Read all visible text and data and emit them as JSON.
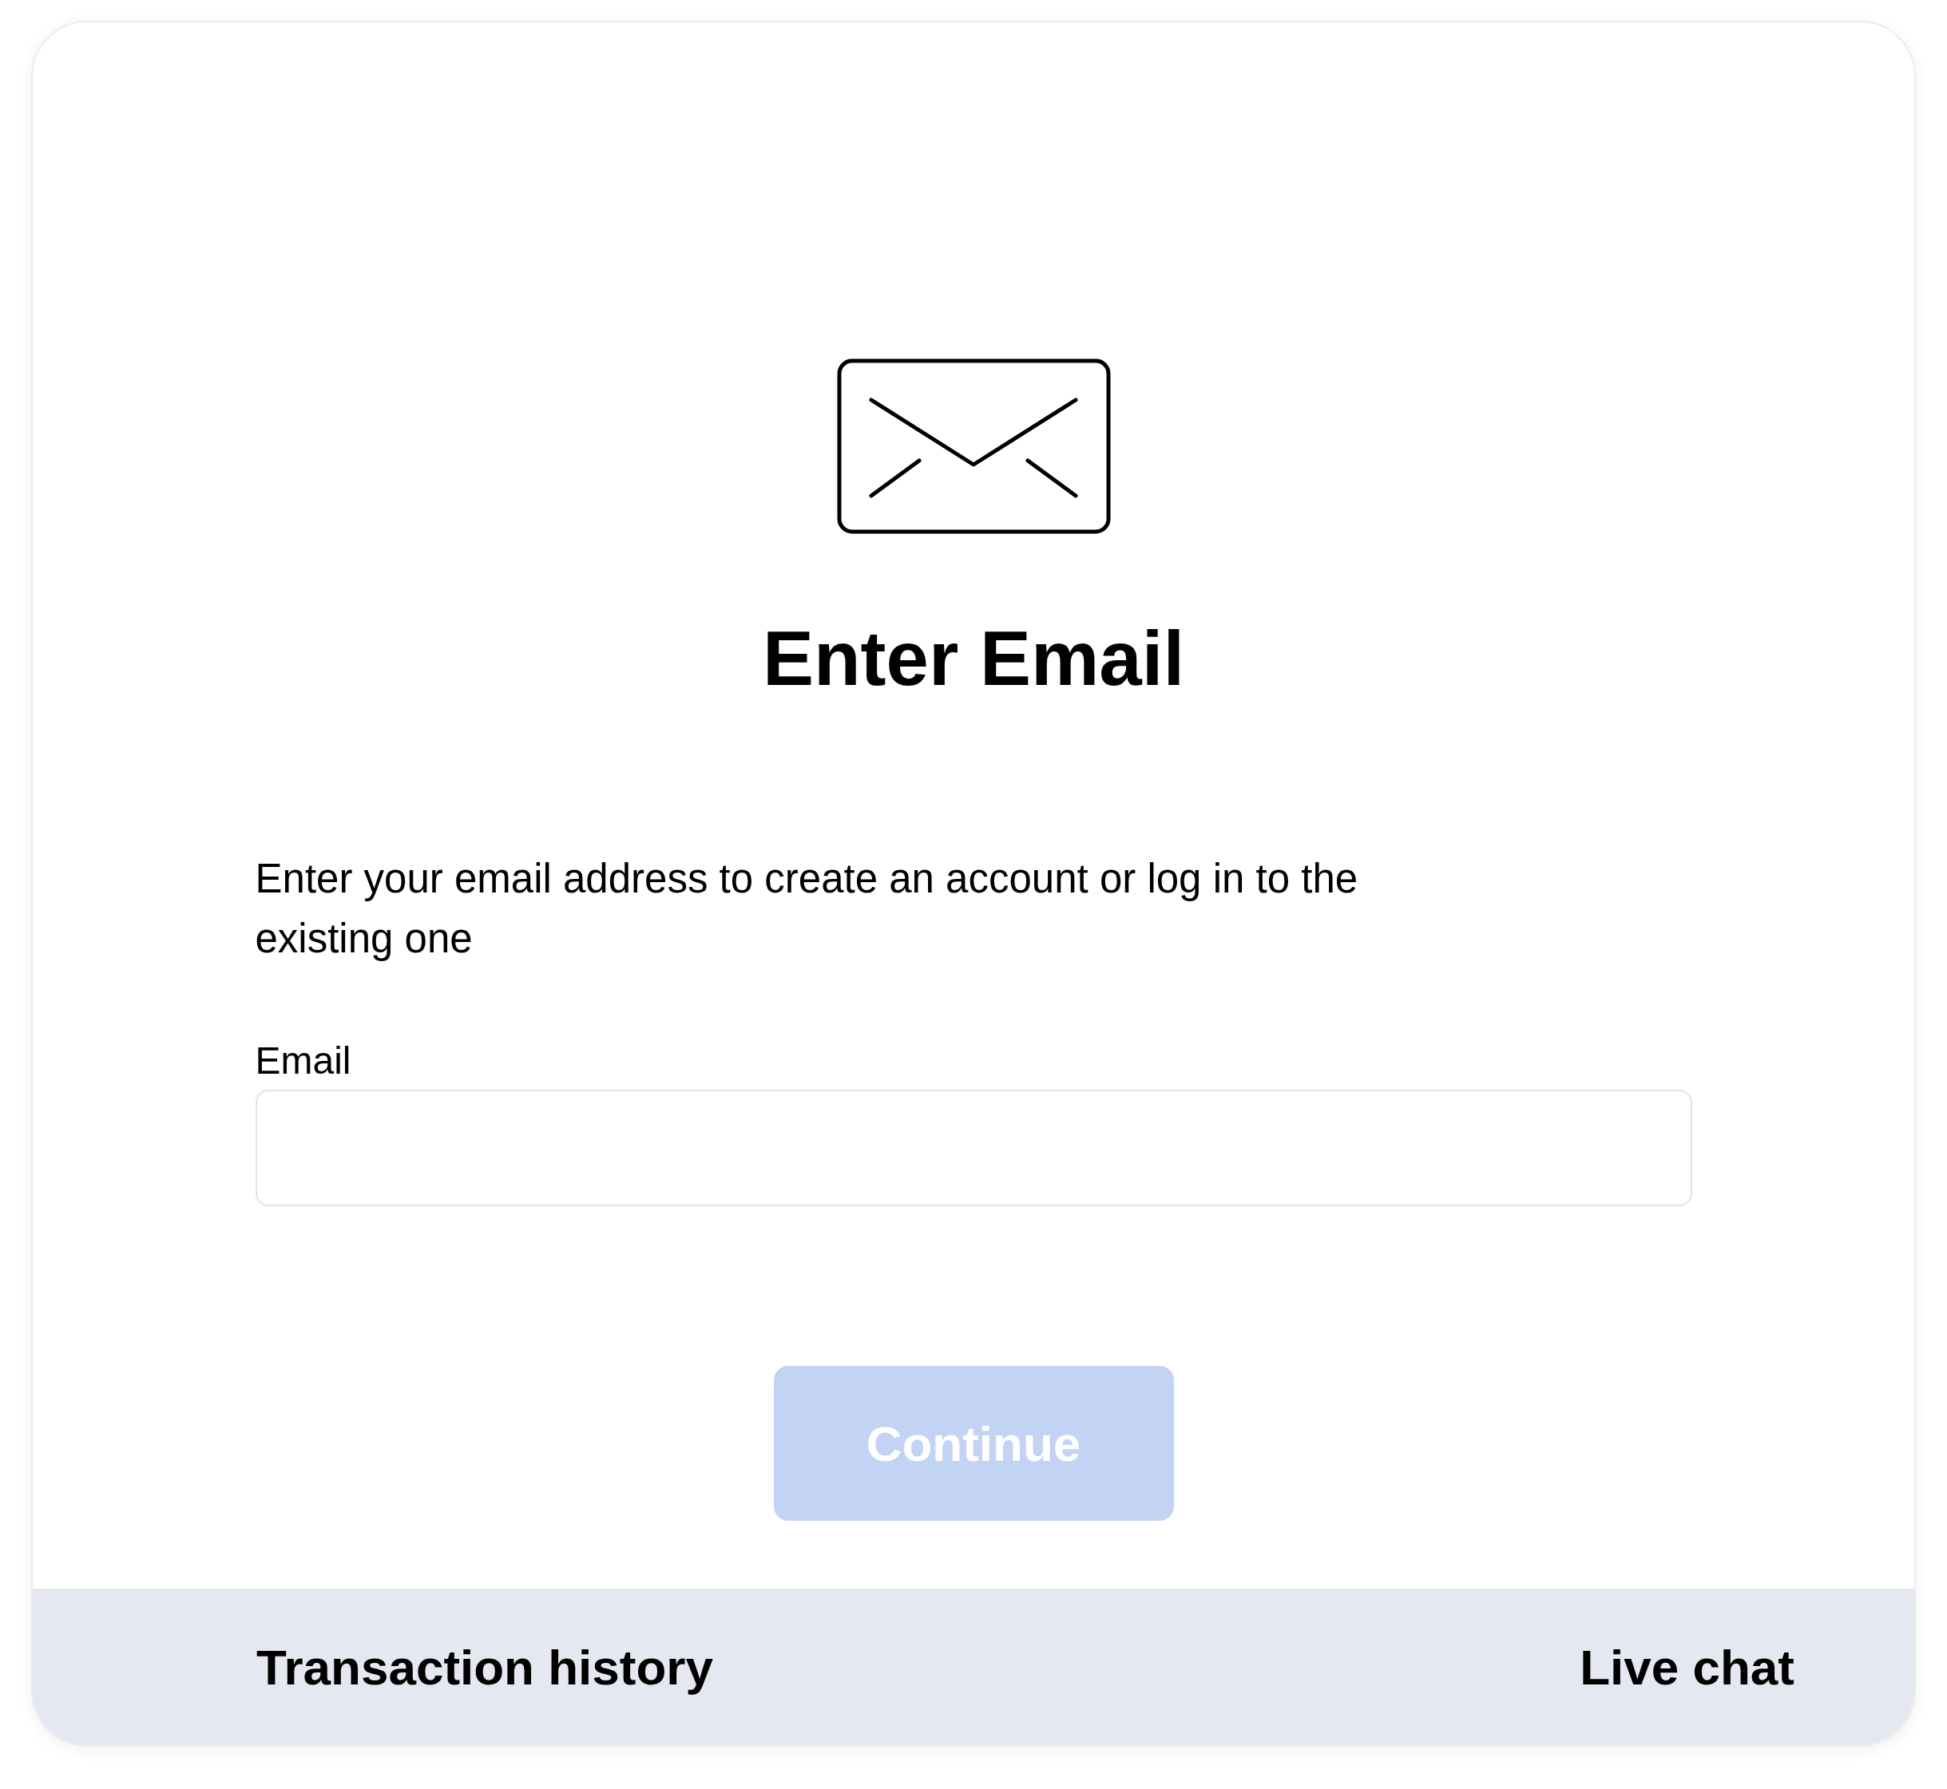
{
  "title": "Enter Email",
  "description": "Enter your email address to create an account or log in to the existing one",
  "email_field": {
    "label": "Email"
  },
  "continue_button": {
    "label": "Continue",
    "disabled": true
  },
  "footer": {
    "links": [
      "Transaction history",
      "Live chat"
    ]
  }
}
